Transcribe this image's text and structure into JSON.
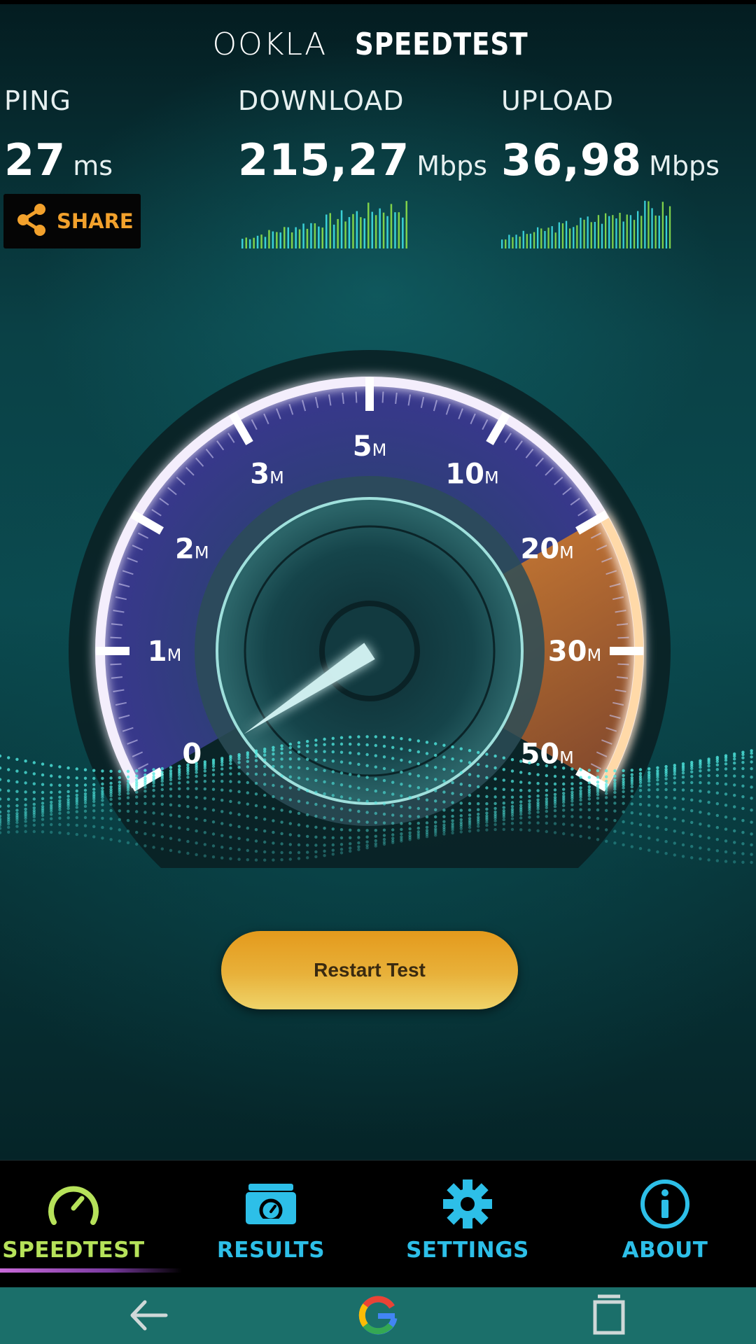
{
  "header": {
    "brand": "OOKLA",
    "product": "SPEEDTEST"
  },
  "stats": {
    "ping": {
      "label": "PING",
      "value": "27",
      "unit": "ms"
    },
    "download": {
      "label": "DOWNLOAD",
      "value": "215,27",
      "unit": "Mbps"
    },
    "upload": {
      "label": "UPLOAD",
      "value": "36,98",
      "unit": "Mbps"
    }
  },
  "share": {
    "label": "SHARE",
    "icon": "share-icon"
  },
  "gauge": {
    "ticks": [
      {
        "num": "0",
        "suffix": ""
      },
      {
        "num": "1",
        "suffix": "M"
      },
      {
        "num": "2",
        "suffix": "M"
      },
      {
        "num": "3",
        "suffix": "M"
      },
      {
        "num": "5",
        "suffix": "M"
      },
      {
        "num": "10",
        "suffix": "M"
      },
      {
        "num": "20",
        "suffix": "M"
      },
      {
        "num": "30",
        "suffix": "M"
      },
      {
        "num": "50",
        "suffix": "M"
      }
    ],
    "needle_fraction": 0.0
  },
  "restart_button": {
    "label": "Restart Test"
  },
  "bottom_nav": {
    "items": [
      {
        "label": "SPEEDTEST",
        "icon": "speedometer-icon",
        "active": true
      },
      {
        "label": "RESULTS",
        "icon": "results-folder-icon",
        "active": false
      },
      {
        "label": "SETTINGS",
        "icon": "gear-icon",
        "active": false
      },
      {
        "label": "ABOUT",
        "icon": "info-icon",
        "active": false
      }
    ]
  },
  "system_nav": {
    "back": "back-arrow-icon",
    "home": "google-g-icon",
    "recents": "recents-icon"
  },
  "colors": {
    "accent_orange": "#f2a12c",
    "active_green": "#b6e25a",
    "nav_blue": "#2dbfe8",
    "sparkline_green": "#7fd14a",
    "sparkline_cyan": "#3ad0d6"
  }
}
